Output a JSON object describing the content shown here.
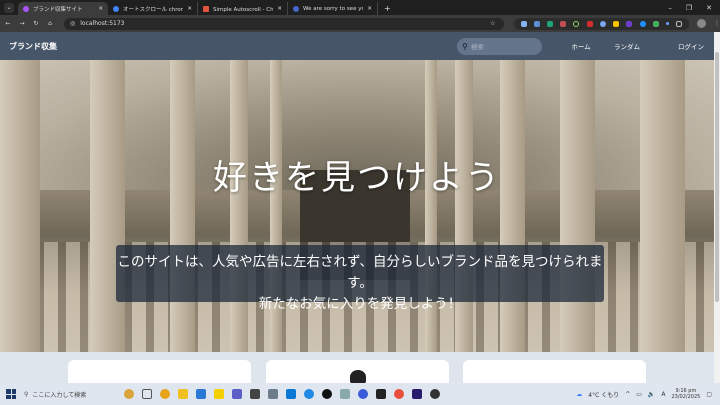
{
  "browser": {
    "tabs": [
      {
        "title": "ブランド収集サイト",
        "active": true,
        "color": "#a855f7"
      },
      {
        "title": "オートスクロール chrome - Google",
        "active": false,
        "color": "#4285f4"
      },
      {
        "title": "Simple Autoscroll - Chrome ウェ",
        "active": false,
        "color": "#e0553c"
      },
      {
        "title": "We are sorry to see you go - Fr",
        "active": false,
        "color": "#4466cc"
      }
    ],
    "new_tab": "+",
    "url": "localhost:5173"
  },
  "app": {
    "brand": "ブランド収集",
    "search_placeholder": "検索",
    "nav": [
      "ホーム",
      "ランダム",
      "ログイン"
    ]
  },
  "hero": {
    "heading": "好きを見つけよう",
    "line1": "このサイトは、人気や広告に左右されず、自分らしいブランド品を見つけられます。",
    "line2": "新たなお気に入りを発見しよう！"
  },
  "taskbar": {
    "search_placeholder": "ここに入力して検索",
    "weather": "4°C くもり",
    "ime": "A",
    "time": "9:16 pm",
    "date": "23/02/2025"
  }
}
